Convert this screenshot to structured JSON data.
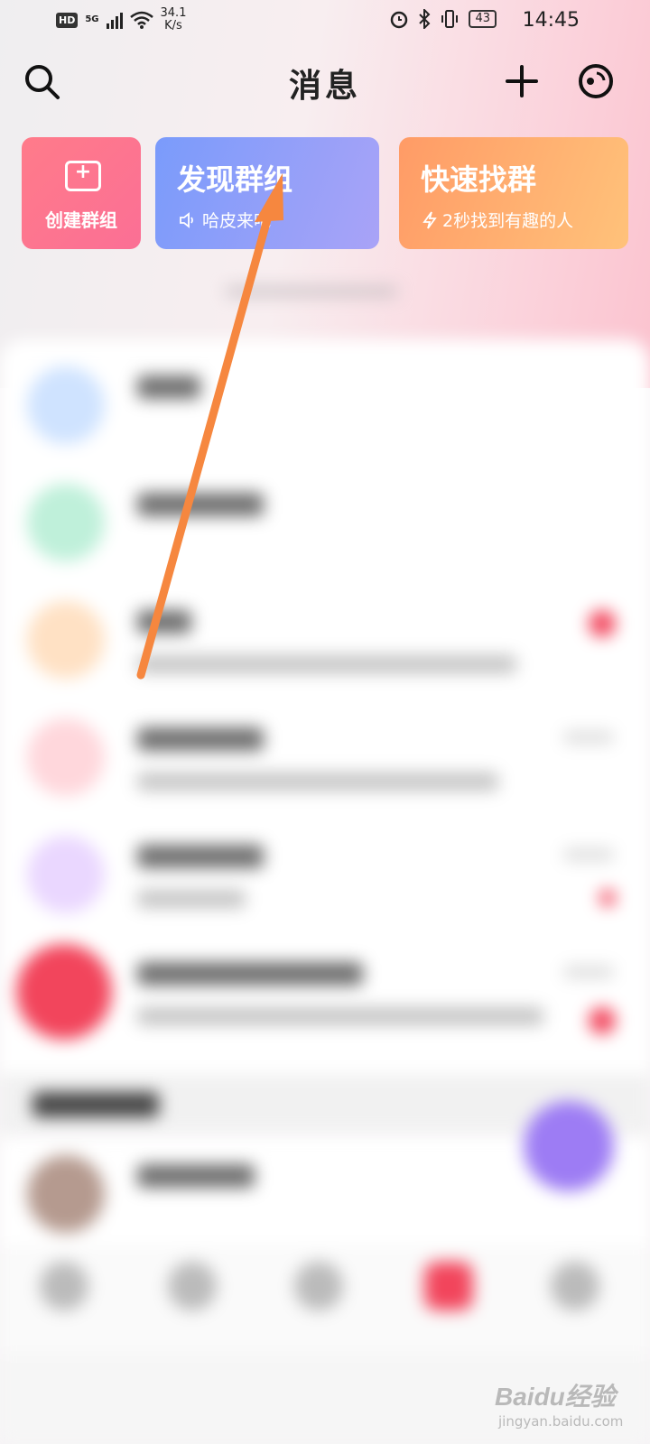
{
  "status_bar": {
    "hd_badge": "HD",
    "network": "5G",
    "speed_value": "34.1",
    "speed_unit": "K/s",
    "battery": "43",
    "time": "14:45"
  },
  "header": {
    "title": "消息",
    "search_icon": "search-icon",
    "add_icon": "plus-icon",
    "extra_icon": "circle-dot-icon"
  },
  "cards": {
    "create": {
      "label": "创建群组",
      "icon": "message-plus-icon"
    },
    "discover": {
      "title": "发现群组",
      "subtitle": "哈皮来吧",
      "icon": "speaker-icon"
    },
    "quick": {
      "title": "快速找群",
      "subtitle": "2秒找到有趣的人",
      "icon": "lightning-icon"
    }
  },
  "colors": {
    "create_card": "#fb7390",
    "discover_card": "#8f9ef9",
    "quick_card": "#ffae70",
    "arrow": "#f6873f",
    "badge_red": "#f2455c"
  },
  "blurred_rows": [
    {
      "avatar_color": "#cfe3ff"
    },
    {
      "avatar_color": "#bff0da"
    },
    {
      "avatar_color": "#ffe1c4"
    },
    {
      "avatar_color": "#ffd7dc"
    },
    {
      "avatar_color": "#ead7ff"
    },
    {
      "avatar_color": "#f2455c"
    }
  ],
  "watermark": {
    "brand": "Baidu经验",
    "url": "jingyan.baidu.com"
  }
}
